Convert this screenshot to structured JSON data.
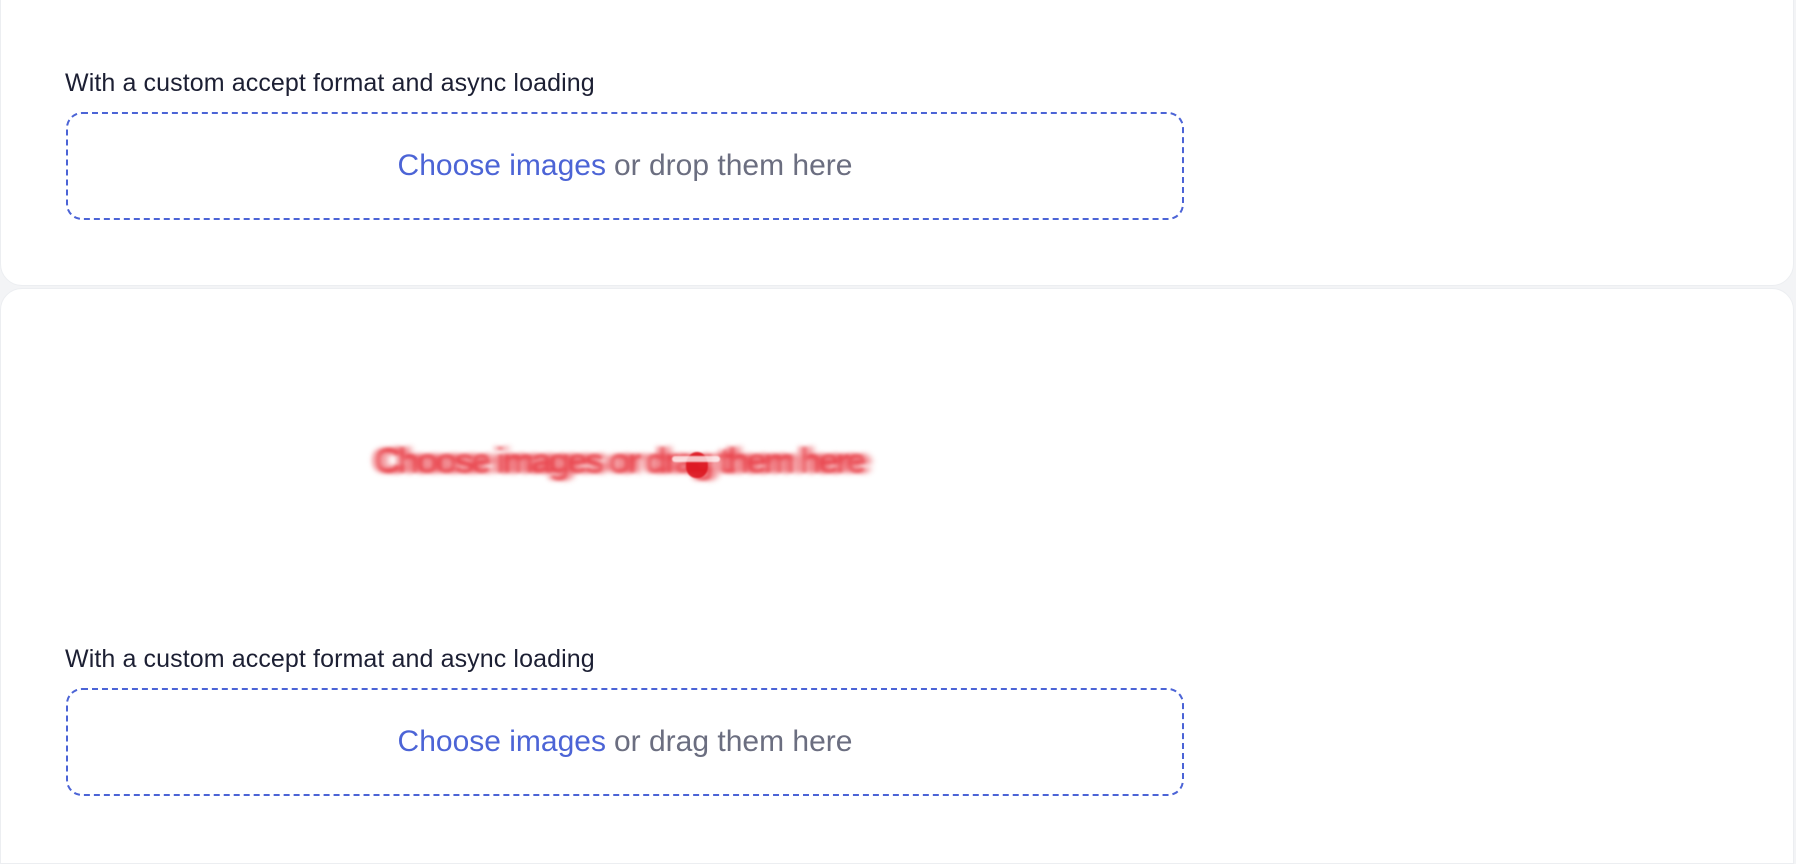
{
  "section_top": {
    "label": "With a custom accept format and async loading",
    "dropzone": {
      "link_text": "Choose images",
      "hint_text": "or drop them here"
    }
  },
  "drag_preview": {
    "text": "Choose images or drag them here"
  },
  "section_bottom": {
    "label": "With a custom accept format and async loading",
    "dropzone": {
      "link_text": "Choose images",
      "hint_text": "or drag them here"
    }
  },
  "colors": {
    "accent": "#4c64d6",
    "text_primary": "#1c1f33",
    "text_muted": "#6b6e80",
    "drag_preview": "#e62832"
  }
}
